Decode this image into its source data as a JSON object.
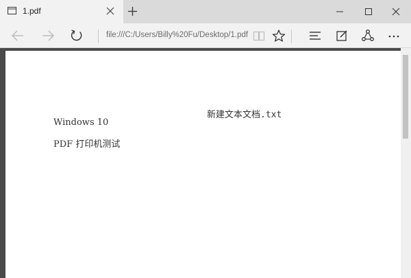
{
  "tab": {
    "title": "1.pdf"
  },
  "address": {
    "url": "file:///C:/Users/Billy%20Fu/Desktop/1.pdf"
  },
  "document": {
    "header": "新建文本文档.txt",
    "lines": [
      "Windows 10",
      "PDF 打印机测试"
    ]
  },
  "icons": {
    "tab": "page-icon",
    "close": "close-icon",
    "new_tab": "plus-icon",
    "minimize": "minimize-icon",
    "maximize": "maximize-icon",
    "window_close": "close-icon",
    "back": "back-arrow-icon",
    "forward": "forward-arrow-icon",
    "refresh": "refresh-icon",
    "reading_view": "book-icon",
    "favorite": "star-icon",
    "hub": "hub-icon",
    "note": "pen-icon",
    "share": "share-icon",
    "more": "more-icon"
  },
  "colors": {
    "chrome": "#f2f2f2",
    "tabstrip": "#dadada",
    "frame": "#4a4a4a"
  }
}
